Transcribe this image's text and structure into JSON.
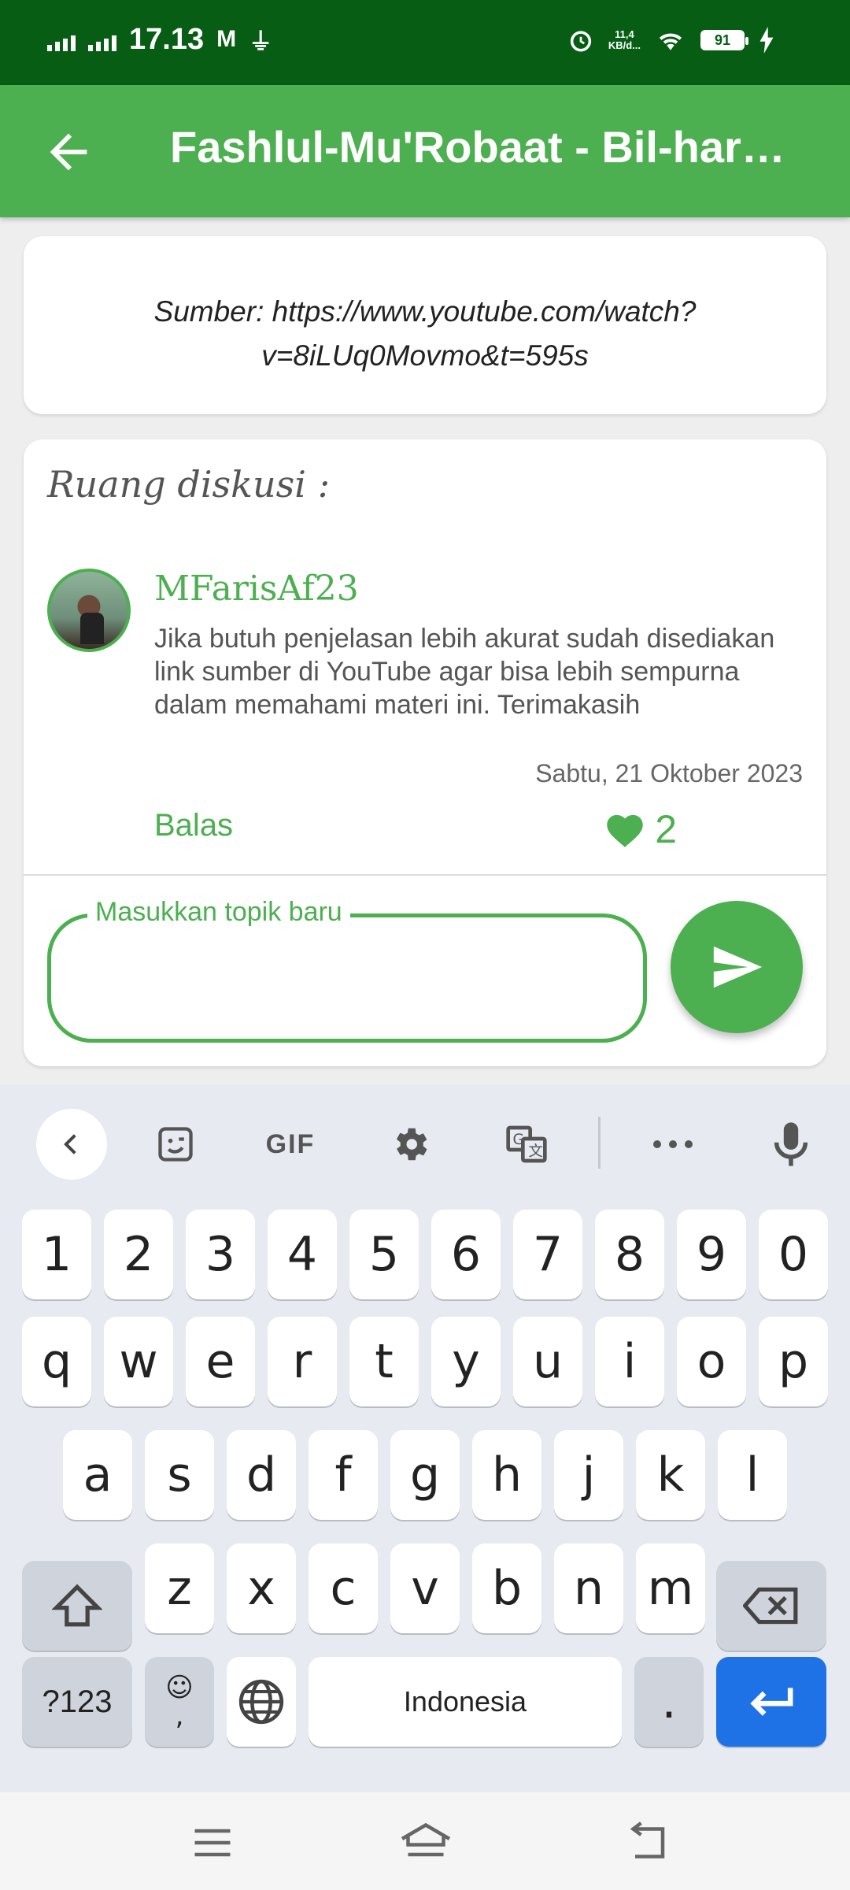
{
  "status_bar": {
    "time": "17.13",
    "net_speed_value": "11,4",
    "net_speed_unit": "KB/d...",
    "battery": "91"
  },
  "appbar": {
    "title": "Fashlul-Mu'Robaat - Bil-harakaat"
  },
  "source": {
    "text": "Sumber: https://www.youtube.com/watch?v=8iLUq0Movmo&t=595s"
  },
  "discussion": {
    "title": "Ruang diskusi :",
    "comment": {
      "username": "MFarisAf23",
      "text": "Jika butuh penjelasan lebih akurat sudah disediakan link sumber di YouTube agar bisa lebih sempurna dalam memahami materi ini. Terimakasih",
      "date": "Sabtu, 21 Oktober 2023",
      "reply_label": "Balas",
      "likes": "2"
    },
    "input": {
      "label": "Masukkan topik baru",
      "value": ""
    }
  },
  "keyboard": {
    "toolbar": [
      "back-icon",
      "sticker-icon",
      "gif",
      "settings-icon",
      "translate-icon",
      "more-icon",
      "mic-icon"
    ],
    "gif_label": "GIF",
    "row_numbers": [
      "1",
      "2",
      "3",
      "4",
      "5",
      "6",
      "7",
      "8",
      "9",
      "0"
    ],
    "row_q": [
      "q",
      "w",
      "e",
      "r",
      "t",
      "y",
      "u",
      "i",
      "o",
      "p"
    ],
    "row_a": [
      "a",
      "s",
      "d",
      "f",
      "g",
      "h",
      "j",
      "k",
      "l"
    ],
    "row_z": [
      "z",
      "x",
      "c",
      "v",
      "b",
      "n",
      "m"
    ],
    "symbols_label": "?123",
    "emoji_label": "☺\n,",
    "space_label": "Indonesia",
    "period_label": "."
  },
  "colors": {
    "accent": "#4caf50",
    "status_bar": "#075d14",
    "enter_key": "#1e72e6"
  }
}
